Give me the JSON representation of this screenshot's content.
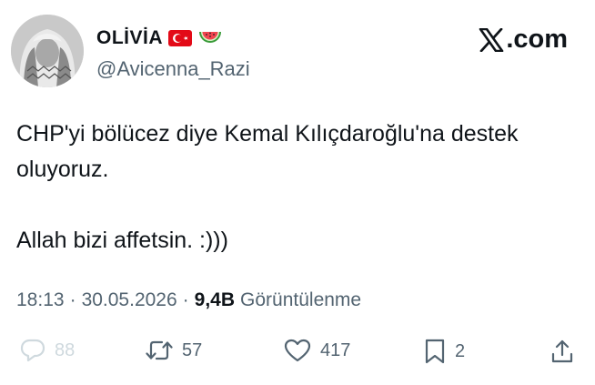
{
  "author": {
    "display_name": "OLİVİA",
    "handle": "@Avicenna_Razi",
    "flag_icon": "turkey-flag-icon",
    "emoji_icon": "watermelon-icon"
  },
  "brand": {
    "label": ".com",
    "logo_icon": "x-logo-icon"
  },
  "tweet": {
    "line1": "CHP'yi bölücez diye Kemal Kılıçdaroğlu'na destek oluyoruz.",
    "line2": "Allah bizi affetsin. :)))"
  },
  "meta": {
    "time": "18:13",
    "date": "30.05.2026",
    "separator": "·",
    "views_count": "9,4B",
    "views_label": "Görüntülenme"
  },
  "actions": {
    "reply_count": "88",
    "retweet_count": "57",
    "like_count": "417",
    "bookmark_count": "2"
  },
  "colors": {
    "text_primary": "#0f1419",
    "text_secondary": "#536471",
    "flag_red": "#e30a17"
  }
}
